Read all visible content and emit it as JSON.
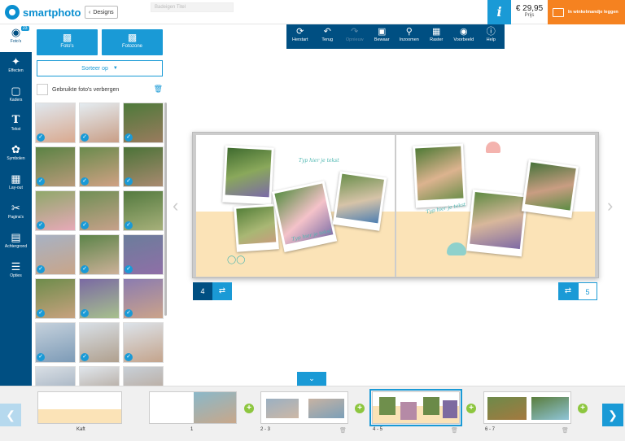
{
  "header": {
    "brand": "smartphoto",
    "designs_label": "Designs",
    "title_placeholder": "Badeigen Titel",
    "price": "€ 29,95",
    "price_label": "Prijs",
    "cart_label": "In winkelmandje leggen",
    "info_label": "i"
  },
  "leftnav": {
    "badge": "23",
    "items": [
      {
        "label": "Foto's",
        "icon": "camera-icon"
      },
      {
        "label": "Effecten",
        "icon": "magic-wand-icon"
      },
      {
        "label": "Kaders",
        "icon": "frame-icon"
      },
      {
        "label": "Tekst",
        "icon": "text-icon"
      },
      {
        "label": "Symbolen",
        "icon": "flower-icon"
      },
      {
        "label": "Lay-out",
        "icon": "layout-icon"
      },
      {
        "label": "Pagina's",
        "icon": "scissors-icon"
      },
      {
        "label": "Achtergrond",
        "icon": "background-icon"
      },
      {
        "label": "Opties",
        "icon": "list-icon"
      }
    ]
  },
  "panel": {
    "add_photos": "Foto's",
    "add_photozone": "Fotozone",
    "sort_label": "Sorteer op",
    "hide_used_label": "Gebruikte foto's verbergen"
  },
  "toolbar": [
    {
      "label": "Herstart",
      "icon": "restart-icon",
      "enabled": true
    },
    {
      "label": "Terug",
      "icon": "undo-icon",
      "enabled": true
    },
    {
      "label": "Opnieuw",
      "icon": "redo-icon",
      "enabled": false
    },
    {
      "label": "Bewaar",
      "icon": "save-icon",
      "enabled": true
    },
    {
      "label": "Inzoomen",
      "icon": "zoom-icon",
      "enabled": true
    },
    {
      "label": "Raster",
      "icon": "grid-icon",
      "enabled": true
    },
    {
      "label": "Voorbeeld",
      "icon": "eye-icon",
      "enabled": true
    },
    {
      "label": "Help",
      "icon": "help-icon",
      "enabled": true
    }
  ],
  "book": {
    "left_caption": "Typ hier je tekst",
    "polaroid_caption_left": "Typ hier je tekst",
    "polaroid_caption_right": "Typ hier je tekst",
    "left_page_number": "4",
    "right_page_number": "5"
  },
  "filmstrip": {
    "spreads": [
      {
        "label": "Kaft"
      },
      {
        "label": "1"
      },
      {
        "label": "2 - 3"
      },
      {
        "label": "4 - 5"
      },
      {
        "label": "6 - 7"
      }
    ]
  },
  "colors": {
    "brand_blue": "#1a9ad6",
    "nav_dark": "#004f82",
    "cart_orange": "#f58220",
    "add_green": "#8dc63f"
  }
}
